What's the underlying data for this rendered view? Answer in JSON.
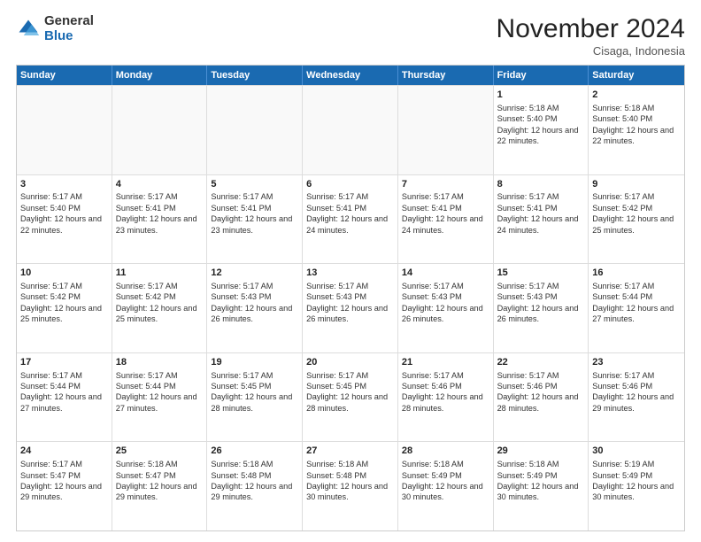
{
  "logo": {
    "general": "General",
    "blue": "Blue"
  },
  "header": {
    "month": "November 2024",
    "location": "Cisaga, Indonesia"
  },
  "weekdays": [
    "Sunday",
    "Monday",
    "Tuesday",
    "Wednesday",
    "Thursday",
    "Friday",
    "Saturday"
  ],
  "weeks": [
    [
      {
        "day": "",
        "info": ""
      },
      {
        "day": "",
        "info": ""
      },
      {
        "day": "",
        "info": ""
      },
      {
        "day": "",
        "info": ""
      },
      {
        "day": "",
        "info": ""
      },
      {
        "day": "1",
        "info": "Sunrise: 5:18 AM\nSunset: 5:40 PM\nDaylight: 12 hours and 22 minutes."
      },
      {
        "day": "2",
        "info": "Sunrise: 5:18 AM\nSunset: 5:40 PM\nDaylight: 12 hours and 22 minutes."
      }
    ],
    [
      {
        "day": "3",
        "info": "Sunrise: 5:17 AM\nSunset: 5:40 PM\nDaylight: 12 hours and 22 minutes."
      },
      {
        "day": "4",
        "info": "Sunrise: 5:17 AM\nSunset: 5:41 PM\nDaylight: 12 hours and 23 minutes."
      },
      {
        "day": "5",
        "info": "Sunrise: 5:17 AM\nSunset: 5:41 PM\nDaylight: 12 hours and 23 minutes."
      },
      {
        "day": "6",
        "info": "Sunrise: 5:17 AM\nSunset: 5:41 PM\nDaylight: 12 hours and 24 minutes."
      },
      {
        "day": "7",
        "info": "Sunrise: 5:17 AM\nSunset: 5:41 PM\nDaylight: 12 hours and 24 minutes."
      },
      {
        "day": "8",
        "info": "Sunrise: 5:17 AM\nSunset: 5:41 PM\nDaylight: 12 hours and 24 minutes."
      },
      {
        "day": "9",
        "info": "Sunrise: 5:17 AM\nSunset: 5:42 PM\nDaylight: 12 hours and 25 minutes."
      }
    ],
    [
      {
        "day": "10",
        "info": "Sunrise: 5:17 AM\nSunset: 5:42 PM\nDaylight: 12 hours and 25 minutes."
      },
      {
        "day": "11",
        "info": "Sunrise: 5:17 AM\nSunset: 5:42 PM\nDaylight: 12 hours and 25 minutes."
      },
      {
        "day": "12",
        "info": "Sunrise: 5:17 AM\nSunset: 5:43 PM\nDaylight: 12 hours and 26 minutes."
      },
      {
        "day": "13",
        "info": "Sunrise: 5:17 AM\nSunset: 5:43 PM\nDaylight: 12 hours and 26 minutes."
      },
      {
        "day": "14",
        "info": "Sunrise: 5:17 AM\nSunset: 5:43 PM\nDaylight: 12 hours and 26 minutes."
      },
      {
        "day": "15",
        "info": "Sunrise: 5:17 AM\nSunset: 5:43 PM\nDaylight: 12 hours and 26 minutes."
      },
      {
        "day": "16",
        "info": "Sunrise: 5:17 AM\nSunset: 5:44 PM\nDaylight: 12 hours and 27 minutes."
      }
    ],
    [
      {
        "day": "17",
        "info": "Sunrise: 5:17 AM\nSunset: 5:44 PM\nDaylight: 12 hours and 27 minutes."
      },
      {
        "day": "18",
        "info": "Sunrise: 5:17 AM\nSunset: 5:44 PM\nDaylight: 12 hours and 27 minutes."
      },
      {
        "day": "19",
        "info": "Sunrise: 5:17 AM\nSunset: 5:45 PM\nDaylight: 12 hours and 28 minutes."
      },
      {
        "day": "20",
        "info": "Sunrise: 5:17 AM\nSunset: 5:45 PM\nDaylight: 12 hours and 28 minutes."
      },
      {
        "day": "21",
        "info": "Sunrise: 5:17 AM\nSunset: 5:46 PM\nDaylight: 12 hours and 28 minutes."
      },
      {
        "day": "22",
        "info": "Sunrise: 5:17 AM\nSunset: 5:46 PM\nDaylight: 12 hours and 28 minutes."
      },
      {
        "day": "23",
        "info": "Sunrise: 5:17 AM\nSunset: 5:46 PM\nDaylight: 12 hours and 29 minutes."
      }
    ],
    [
      {
        "day": "24",
        "info": "Sunrise: 5:17 AM\nSunset: 5:47 PM\nDaylight: 12 hours and 29 minutes."
      },
      {
        "day": "25",
        "info": "Sunrise: 5:18 AM\nSunset: 5:47 PM\nDaylight: 12 hours and 29 minutes."
      },
      {
        "day": "26",
        "info": "Sunrise: 5:18 AM\nSunset: 5:48 PM\nDaylight: 12 hours and 29 minutes."
      },
      {
        "day": "27",
        "info": "Sunrise: 5:18 AM\nSunset: 5:48 PM\nDaylight: 12 hours and 30 minutes."
      },
      {
        "day": "28",
        "info": "Sunrise: 5:18 AM\nSunset: 5:49 PM\nDaylight: 12 hours and 30 minutes."
      },
      {
        "day": "29",
        "info": "Sunrise: 5:18 AM\nSunset: 5:49 PM\nDaylight: 12 hours and 30 minutes."
      },
      {
        "day": "30",
        "info": "Sunrise: 5:19 AM\nSunset: 5:49 PM\nDaylight: 12 hours and 30 minutes."
      }
    ]
  ]
}
